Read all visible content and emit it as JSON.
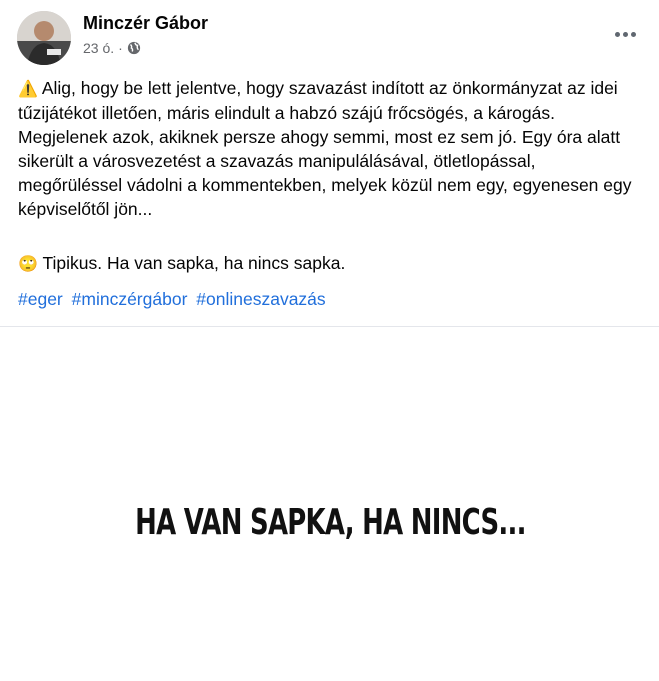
{
  "post": {
    "author": "Minczér Gábor",
    "time": "23 ó.",
    "separator": "·",
    "privacy_icon": "globe-icon",
    "more_icon": "more-options-icon",
    "paragraph1_emoji": "⚠️",
    "paragraph1": " Alig, hogy be lett jelentve, hogy szavazást indított az önkormányzat az idei tűzijátékot illetően, máris elindult a habzó szájú frőcsögés, a károgás. Megjelenek azok, akiknek persze ahogy semmi, most ez sem jó. Egy óra alatt sikerült a városvezetést a szavazás manipulálásával, ötletlopással, megőrüléssel vádolni a kommentekben, melyek közül nem egy, egyenesen egy képviselőtől jön...",
    "paragraph2_emoji": "🙄",
    "paragraph2": " Tipikus. Ha van sapka, ha nincs sapka.",
    "hashtags": [
      "#eger",
      "#minczérgábor",
      "#onlineszavazás"
    ]
  },
  "media": {
    "caption": "HA VAN SAPKA, HA NINCS..."
  },
  "colors": {
    "link": "#216fdb",
    "meta": "#65676b",
    "text": "#050505"
  }
}
